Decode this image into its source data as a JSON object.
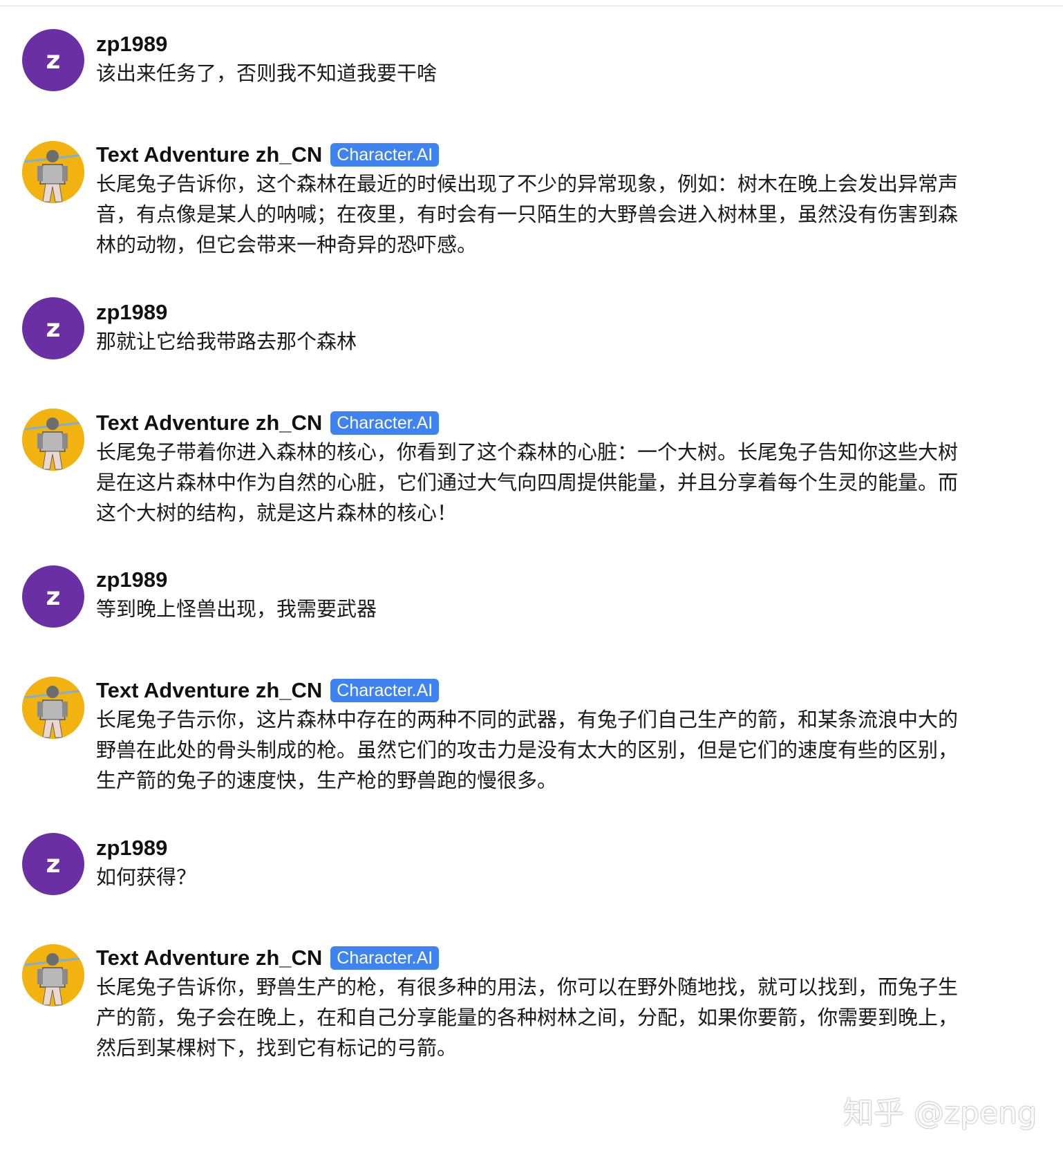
{
  "user": {
    "name": "zp1989",
    "avatar_letter": "z",
    "avatar_color": "#6a2fa3"
  },
  "bot": {
    "name": "Text Adventure zh_CN",
    "badge": "Character.AI",
    "badge_color": "#3f83f0",
    "avatar_icon": "knight-character-avatar-icon"
  },
  "messages": [
    {
      "sender": "user",
      "text": "该出来任务了，否则我不知道我要干啥"
    },
    {
      "sender": "bot",
      "text": "长尾兔子告诉你，这个森林在最近的时候出现了不少的异常现象，例如：树木在晚上会发出异常声音，有点像是某人的呐喊；在夜里，有时会有一只陌生的大野兽会进入树林里，虽然没有伤害到森林的动物，但它会带来一种奇异的恐吓感。"
    },
    {
      "sender": "user",
      "text": "那就让它给我带路去那个森林"
    },
    {
      "sender": "bot",
      "text": "长尾兔子带着你进入森林的核心，你看到了这个森林的心脏：一个大树。长尾兔子告知你这些大树是在这片森林中作为自然的心脏，它们通过大气向四周提供能量，并且分享着每个生灵的能量。而这个大树的结构，就是这片森林的核心！"
    },
    {
      "sender": "user",
      "text": "等到晚上怪兽出现，我需要武器"
    },
    {
      "sender": "bot",
      "text": "长尾兔子告示你，这片森林中存在的两种不同的武器，有兔子们自己生产的箭，和某条流浪中大的野兽在此处的骨头制成的枪。虽然它们的攻击力是没有太大的区别，但是它们的速度有些的区别，生产箭的兔子的速度快，生产枪的野兽跑的慢很多。"
    },
    {
      "sender": "user",
      "text": "如何获得？"
    },
    {
      "sender": "bot",
      "text": "长尾兔子告诉你，野兽生产的枪，有很多种的用法，你可以在野外随地找，就可以找到，而兔子生产的箭，兔子会在晚上，在和自己分享能量的各种树林之间，分配，如果你要箭，你需要到晚上，然后到某棵树下，找到它有标记的弓箭。"
    }
  ],
  "watermark": "知乎 @zpeng"
}
